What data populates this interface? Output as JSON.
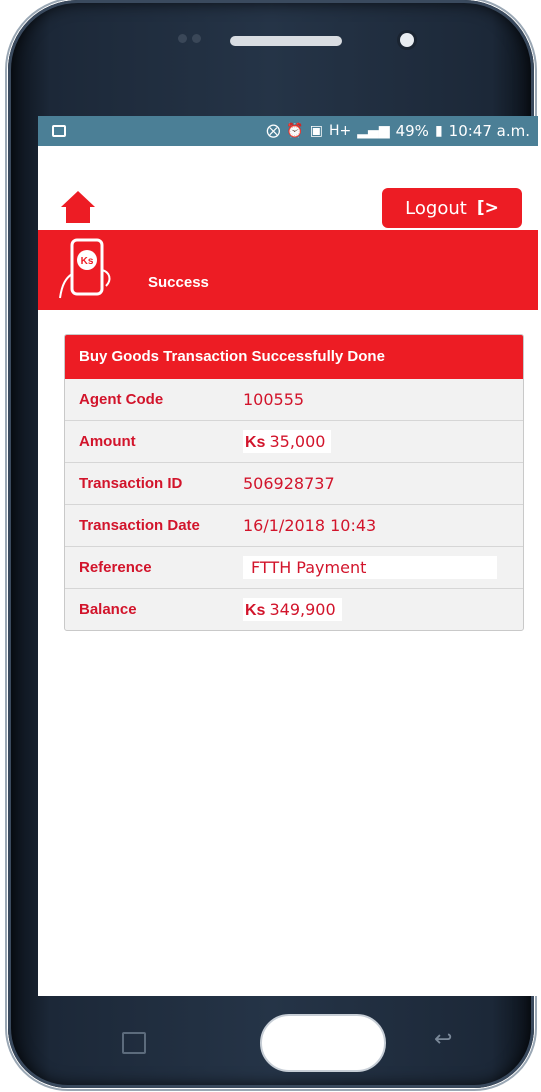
{
  "status_bar": {
    "icons": [
      "mute-icon",
      "alarm-icon",
      "nfc-icon",
      "hplus-icon",
      "signal-icon"
    ],
    "battery": "49%",
    "time": "10:47 a.m."
  },
  "header": {
    "home_icon": "home-icon",
    "logout_label": "Logout",
    "logout_icon": "logout-icon"
  },
  "banner": {
    "logo_text": "Ks",
    "title": "Success"
  },
  "transaction": {
    "header": "Buy Goods Transaction Successfully Done",
    "rows": [
      {
        "label": "Agent Code",
        "prefix": "",
        "value": "100555"
      },
      {
        "label": "Amount",
        "prefix": "Ks",
        "value": "35,000"
      },
      {
        "label": "Transaction ID",
        "prefix": "",
        "value": "506928737"
      },
      {
        "label": "Transaction Date",
        "prefix": "",
        "value": "16/1/2018 10:43"
      },
      {
        "label": "Reference",
        "prefix": "",
        "value": "FTTH Payment"
      },
      {
        "label": "Balance",
        "prefix": "Ks",
        "value": "349,900"
      }
    ]
  },
  "colors": {
    "brand_red": "#ed1c24",
    "status_bar": "#4b7f96",
    "label_red": "#d2142b"
  }
}
